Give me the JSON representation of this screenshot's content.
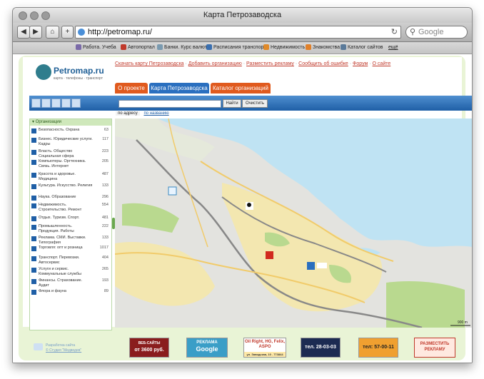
{
  "window": {
    "title": "Карта Петрозаводска"
  },
  "toolbar": {
    "url": "http://petromap.ru/",
    "search_placeholder": "Google"
  },
  "bookmarks": [
    "Работа. Учеба",
    "Автопортал",
    "Банки. Курс валют",
    "Расписания транспорта",
    "Недвижимость",
    "Знакомства",
    "Каталог сайтов",
    "ещё"
  ],
  "site": {
    "logo_name": "Petromap.ru",
    "logo_tagline": "карта · телефоны · транспорт",
    "top_links": [
      "Скачать карту Петрозаводска",
      "Добавить организацию",
      "Разместить рекламу",
      "Сообщить об ошибке",
      "Форум",
      "О сайте"
    ],
    "tabs": [
      "О проекте",
      "Карта Петрозаводска",
      "Каталог организаций"
    ],
    "search_button": "Найти",
    "clear_button": "Очистить",
    "subtabs": [
      "по адресу",
      "по названию"
    ]
  },
  "sidebar": {
    "title": "Организации",
    "items": [
      {
        "label": "Безопасность. Охрана",
        "count": "63"
      },
      {
        "label": "Бизнес. Юридические услуги. Кадры",
        "count": "117"
      },
      {
        "label": "Власть. Общество Социальная сфера",
        "count": "223"
      },
      {
        "label": "Компьютеры. Оргтехника. Связь. Интернет",
        "count": "205"
      },
      {
        "label": "Красота и здоровье. Медицина",
        "count": "487"
      },
      {
        "label": "Культура. Искусство. Религия",
        "count": "133"
      },
      {
        "label": "Наука. Образование",
        "count": "296"
      },
      {
        "label": "Недвижимость. Строительство. Ремонт",
        "count": "554"
      },
      {
        "label": "Отдых. Туризм. Спорт.",
        "count": "481"
      },
      {
        "label": "Промышленность. Продукция. Работы",
        "count": "222"
      },
      {
        "label": "Реклама. СМИ. Выставки. Типография",
        "count": "133"
      },
      {
        "label": "Торговля: опт и розница",
        "count": "1017"
      },
      {
        "label": "Транспорт. Перевозки. Автосервис",
        "count": "404"
      },
      {
        "label": "Услуги и сервис. Коммунальные службы",
        "count": "265"
      },
      {
        "label": "Финансы. Страхование. Аудит",
        "count": "193"
      },
      {
        "label": "Флора и фауна",
        "count": "89"
      }
    ]
  },
  "map": {
    "scale_label": "900 m"
  },
  "footer": {
    "dev_line1": "Разработка сайта",
    "dev_line2": "© Студия \"Медведев\"",
    "banners": [
      {
        "line1": "ВЕБ-САЙТЫ",
        "line2": "от 3600 руб."
      },
      {
        "line1": "РЕКЛАМА",
        "line2": "Google"
      },
      {
        "line1": "Oil Right, HG, Felix, ASPO",
        "line2": "ул. Заводская, 10 . 773844"
      },
      {
        "line1": "тел. 28-03-03",
        "line2": ""
      },
      {
        "line1": "тел: 57-00-11",
        "line2": ""
      },
      {
        "line1": "РАЗМЕСТИТЬ",
        "line2": "РЕКЛАМУ"
      }
    ]
  }
}
